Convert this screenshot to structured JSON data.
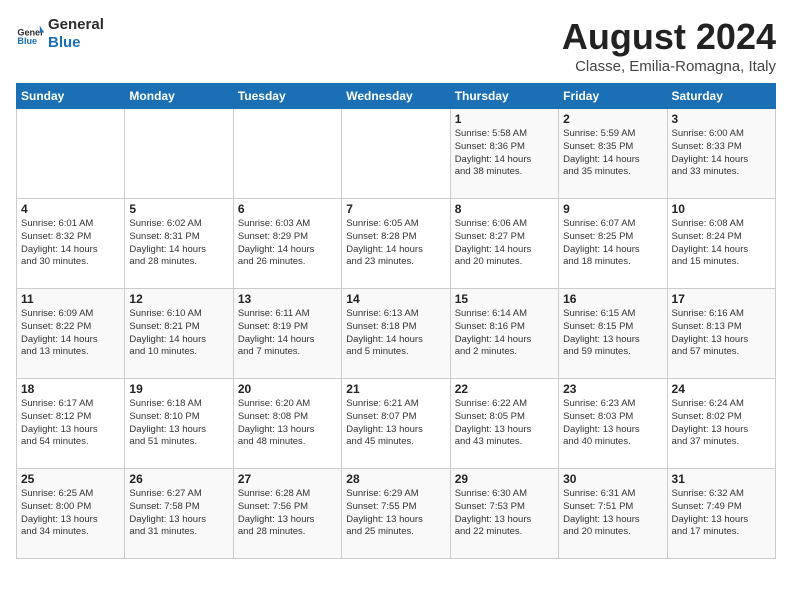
{
  "logo": {
    "line1": "General",
    "line2": "Blue"
  },
  "title": "August 2024",
  "subtitle": "Classe, Emilia-Romagna, Italy",
  "days_of_week": [
    "Sunday",
    "Monday",
    "Tuesday",
    "Wednesday",
    "Thursday",
    "Friday",
    "Saturday"
  ],
  "weeks": [
    [
      {
        "day": "",
        "info": ""
      },
      {
        "day": "",
        "info": ""
      },
      {
        "day": "",
        "info": ""
      },
      {
        "day": "",
        "info": ""
      },
      {
        "day": "1",
        "info": "Sunrise: 5:58 AM\nSunset: 8:36 PM\nDaylight: 14 hours\nand 38 minutes."
      },
      {
        "day": "2",
        "info": "Sunrise: 5:59 AM\nSunset: 8:35 PM\nDaylight: 14 hours\nand 35 minutes."
      },
      {
        "day": "3",
        "info": "Sunrise: 6:00 AM\nSunset: 8:33 PM\nDaylight: 14 hours\nand 33 minutes."
      }
    ],
    [
      {
        "day": "4",
        "info": "Sunrise: 6:01 AM\nSunset: 8:32 PM\nDaylight: 14 hours\nand 30 minutes."
      },
      {
        "day": "5",
        "info": "Sunrise: 6:02 AM\nSunset: 8:31 PM\nDaylight: 14 hours\nand 28 minutes."
      },
      {
        "day": "6",
        "info": "Sunrise: 6:03 AM\nSunset: 8:29 PM\nDaylight: 14 hours\nand 26 minutes."
      },
      {
        "day": "7",
        "info": "Sunrise: 6:05 AM\nSunset: 8:28 PM\nDaylight: 14 hours\nand 23 minutes."
      },
      {
        "day": "8",
        "info": "Sunrise: 6:06 AM\nSunset: 8:27 PM\nDaylight: 14 hours\nand 20 minutes."
      },
      {
        "day": "9",
        "info": "Sunrise: 6:07 AM\nSunset: 8:25 PM\nDaylight: 14 hours\nand 18 minutes."
      },
      {
        "day": "10",
        "info": "Sunrise: 6:08 AM\nSunset: 8:24 PM\nDaylight: 14 hours\nand 15 minutes."
      }
    ],
    [
      {
        "day": "11",
        "info": "Sunrise: 6:09 AM\nSunset: 8:22 PM\nDaylight: 14 hours\nand 13 minutes."
      },
      {
        "day": "12",
        "info": "Sunrise: 6:10 AM\nSunset: 8:21 PM\nDaylight: 14 hours\nand 10 minutes."
      },
      {
        "day": "13",
        "info": "Sunrise: 6:11 AM\nSunset: 8:19 PM\nDaylight: 14 hours\nand 7 minutes."
      },
      {
        "day": "14",
        "info": "Sunrise: 6:13 AM\nSunset: 8:18 PM\nDaylight: 14 hours\nand 5 minutes."
      },
      {
        "day": "15",
        "info": "Sunrise: 6:14 AM\nSunset: 8:16 PM\nDaylight: 14 hours\nand 2 minutes."
      },
      {
        "day": "16",
        "info": "Sunrise: 6:15 AM\nSunset: 8:15 PM\nDaylight: 13 hours\nand 59 minutes."
      },
      {
        "day": "17",
        "info": "Sunrise: 6:16 AM\nSunset: 8:13 PM\nDaylight: 13 hours\nand 57 minutes."
      }
    ],
    [
      {
        "day": "18",
        "info": "Sunrise: 6:17 AM\nSunset: 8:12 PM\nDaylight: 13 hours\nand 54 minutes."
      },
      {
        "day": "19",
        "info": "Sunrise: 6:18 AM\nSunset: 8:10 PM\nDaylight: 13 hours\nand 51 minutes."
      },
      {
        "day": "20",
        "info": "Sunrise: 6:20 AM\nSunset: 8:08 PM\nDaylight: 13 hours\nand 48 minutes."
      },
      {
        "day": "21",
        "info": "Sunrise: 6:21 AM\nSunset: 8:07 PM\nDaylight: 13 hours\nand 45 minutes."
      },
      {
        "day": "22",
        "info": "Sunrise: 6:22 AM\nSunset: 8:05 PM\nDaylight: 13 hours\nand 43 minutes."
      },
      {
        "day": "23",
        "info": "Sunrise: 6:23 AM\nSunset: 8:03 PM\nDaylight: 13 hours\nand 40 minutes."
      },
      {
        "day": "24",
        "info": "Sunrise: 6:24 AM\nSunset: 8:02 PM\nDaylight: 13 hours\nand 37 minutes."
      }
    ],
    [
      {
        "day": "25",
        "info": "Sunrise: 6:25 AM\nSunset: 8:00 PM\nDaylight: 13 hours\nand 34 minutes."
      },
      {
        "day": "26",
        "info": "Sunrise: 6:27 AM\nSunset: 7:58 PM\nDaylight: 13 hours\nand 31 minutes."
      },
      {
        "day": "27",
        "info": "Sunrise: 6:28 AM\nSunset: 7:56 PM\nDaylight: 13 hours\nand 28 minutes."
      },
      {
        "day": "28",
        "info": "Sunrise: 6:29 AM\nSunset: 7:55 PM\nDaylight: 13 hours\nand 25 minutes."
      },
      {
        "day": "29",
        "info": "Sunrise: 6:30 AM\nSunset: 7:53 PM\nDaylight: 13 hours\nand 22 minutes."
      },
      {
        "day": "30",
        "info": "Sunrise: 6:31 AM\nSunset: 7:51 PM\nDaylight: 13 hours\nand 20 minutes."
      },
      {
        "day": "31",
        "info": "Sunrise: 6:32 AM\nSunset: 7:49 PM\nDaylight: 13 hours\nand 17 minutes."
      }
    ]
  ]
}
